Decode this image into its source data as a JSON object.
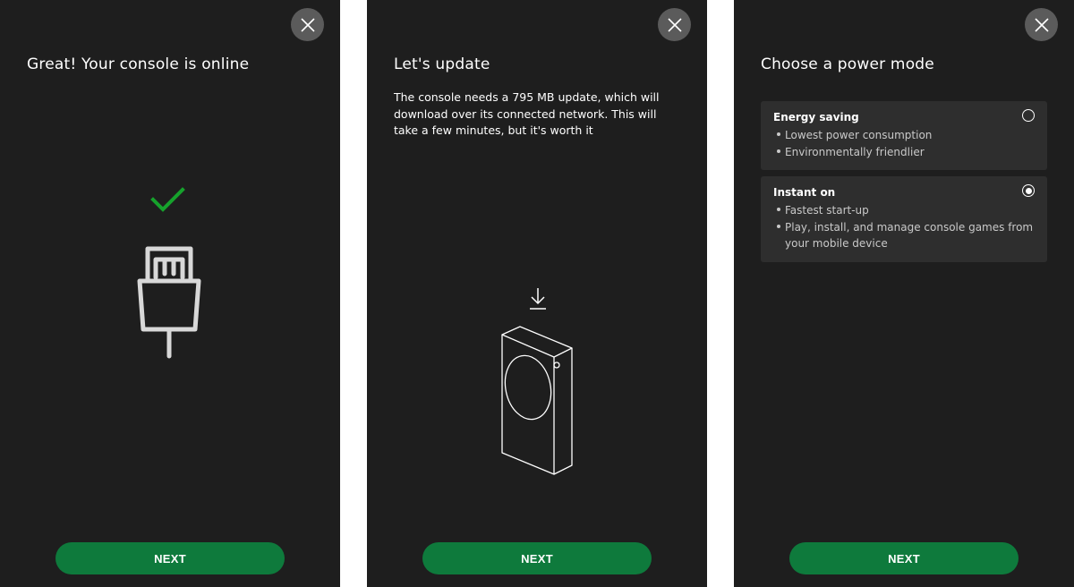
{
  "colors": {
    "panel_background": "#1e1e1e",
    "accent_green": "#0e7a3c",
    "check_green": "#16a12c",
    "close_button": "#5b5b5b",
    "option_card": "#2e2e2e"
  },
  "screens": [
    {
      "title": "Great! Your console is online",
      "illustration": [
        "checkmark-icon",
        "ethernet-plug-icon"
      ],
      "close_icon": "close-icon",
      "next_label": "NEXT"
    },
    {
      "title": "Let's update",
      "description": "The console needs a 795 MB update, which will download over its connected network. This will take a few minutes, but it's worth it",
      "illustration": [
        "download-arrow-icon",
        "console-icon"
      ],
      "close_icon": "close-icon",
      "next_label": "NEXT"
    },
    {
      "title": "Choose a power mode",
      "close_icon": "close-icon",
      "options": [
        {
          "title": "Energy saving",
          "bullets": [
            "Lowest power consumption",
            "Environmentally friendlier"
          ],
          "selected": false
        },
        {
          "title": "Instant on",
          "bullets": [
            "Fastest start-up",
            "Play, install, and manage console games from your mobile device"
          ],
          "selected": true
        }
      ],
      "next_label": "NEXT"
    }
  ]
}
